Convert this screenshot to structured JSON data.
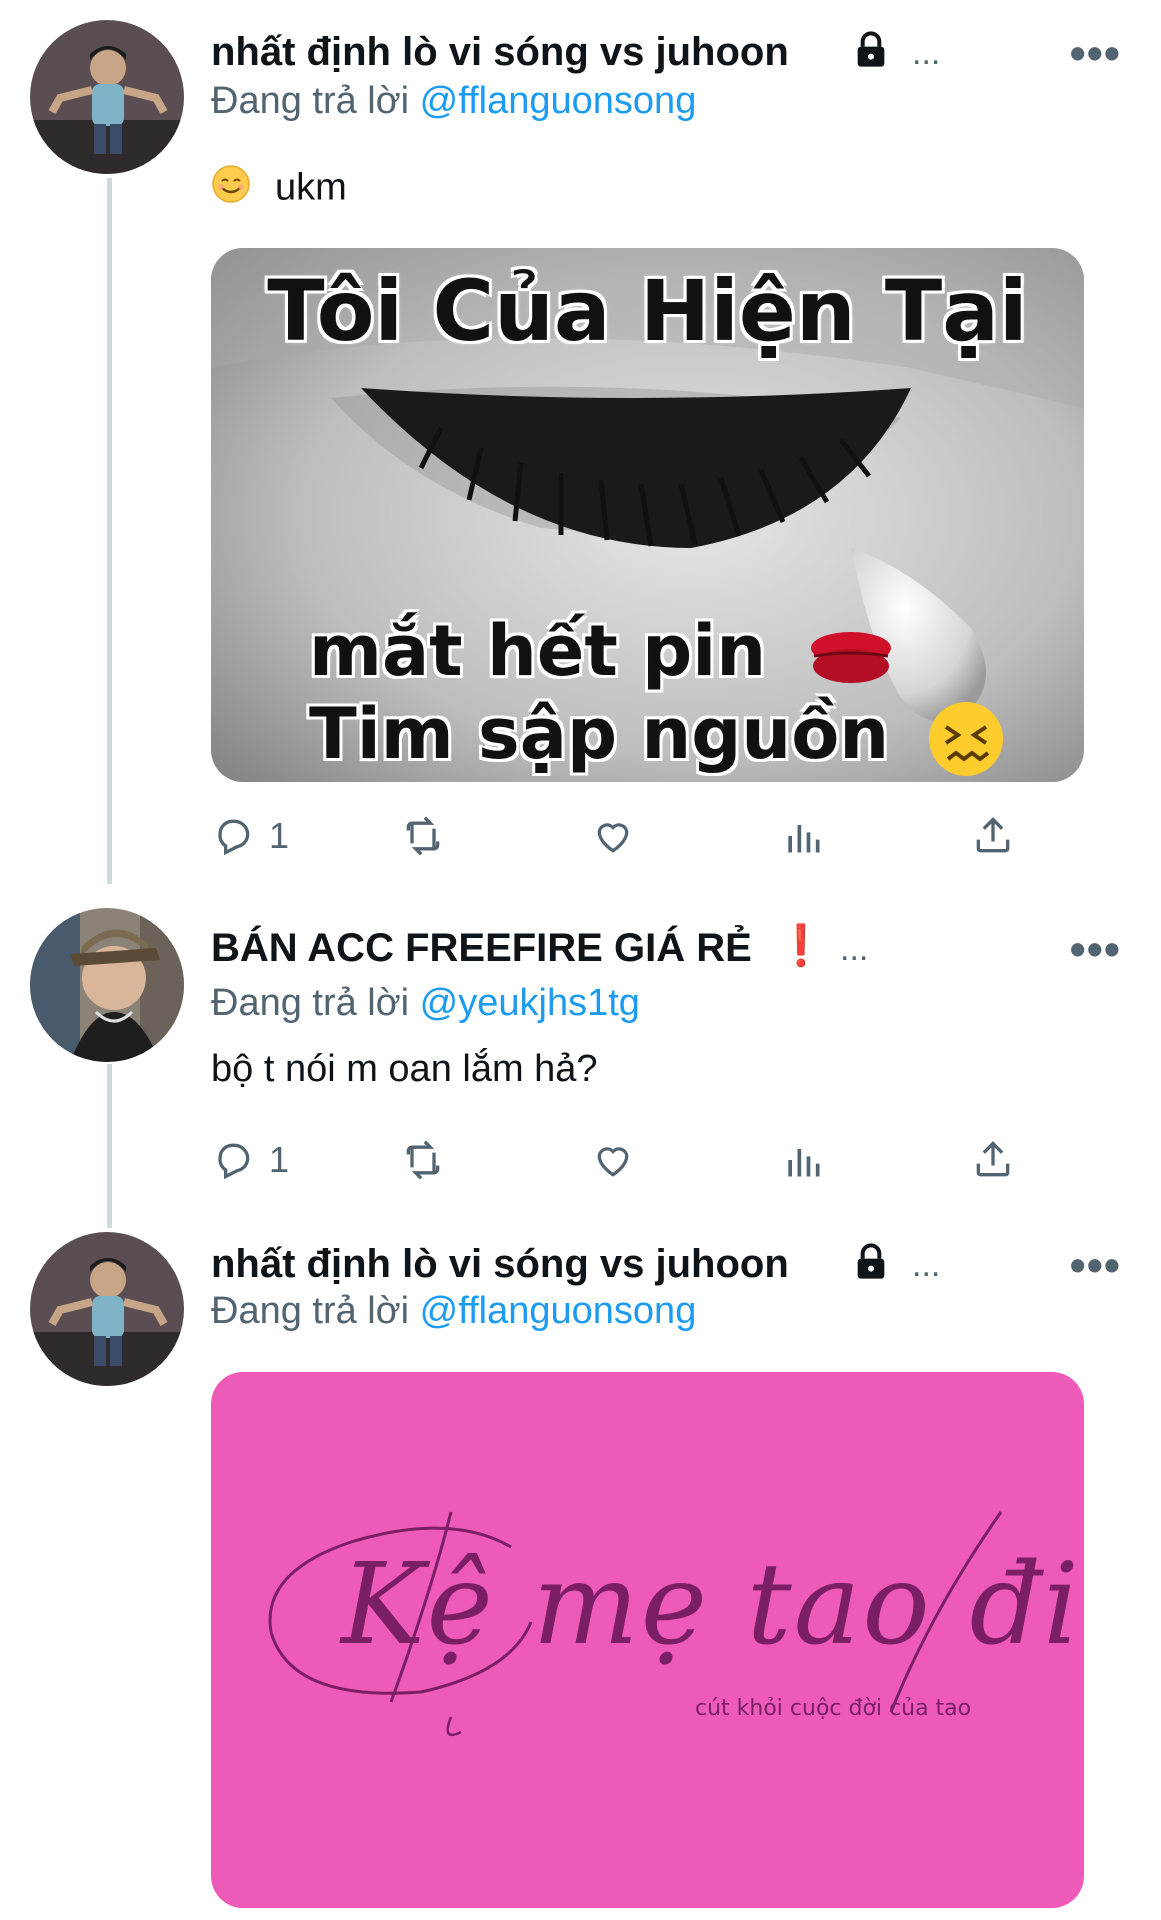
{
  "tweets": [
    {
      "display_name": "nhất định lò vi sóng vs juhoon",
      "badge_icon": "lock-icon",
      "trail": "...",
      "more": "•••",
      "replying_prefix": "Đang trả lời",
      "replying_handle": "@fflanguonsong",
      "text": "ukm",
      "text_icon": "smiling-face-emoji",
      "media": {
        "title": "Tôi Của Hiện Tại",
        "line1": "mắt hết pin",
        "line2": "Tim sập nguồn"
      },
      "actions": {
        "reply_count": "1"
      }
    },
    {
      "display_name": "BÁN ACC FREEFIRE GIÁ RẺ",
      "badge": "❗",
      "trail": "...",
      "more": "•••",
      "replying_prefix": "Đang trả lời",
      "replying_handle": "@yeukjhs1tg",
      "text": "bộ t nói m oan lắm hả?",
      "actions": {
        "reply_count": "1"
      }
    },
    {
      "display_name": "nhất định lò vi sóng vs juhoon",
      "badge_icon": "lock-icon",
      "trail": "...",
      "more": "•••",
      "replying_prefix": "Đang trả lời",
      "replying_handle": "@fflanguonsong",
      "media": {
        "script_text": "Kệ mẹ tao đi",
        "subtext": "cút khỏi cuộc đời của tao",
        "background": "#ee5ab8"
      }
    }
  ],
  "colors": {
    "link": "#1d9bf0",
    "secondary_text": "#536471",
    "thread_line": "#cfd9de"
  }
}
